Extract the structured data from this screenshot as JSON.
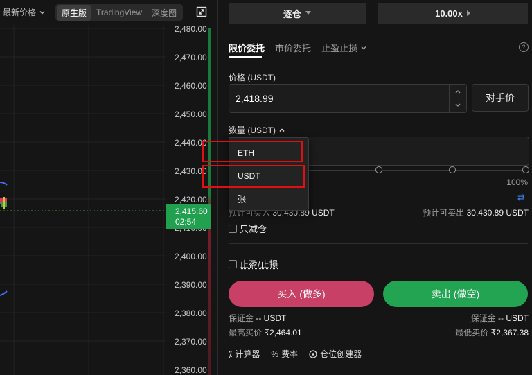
{
  "chart_toolbar": {
    "price_type": "最新价格",
    "views": [
      "原生版",
      "TradingView",
      "深度图"
    ],
    "active_view": "原生版"
  },
  "price_axis": {
    "ticks": [
      "2,480.00",
      "2,470.00",
      "2,460.00",
      "2,450.00",
      "2,440.00",
      "2,430.00",
      "2,420.00",
      "2,410.00",
      "2,400.00",
      "2,390.00",
      "2,380.00",
      "2,370.00",
      "2,360.00"
    ],
    "current_price": "2,415.60",
    "countdown": "02:54",
    "current_color": "#21a14f"
  },
  "order_panel": {
    "margin_mode": "逐仓",
    "leverage": "10.00x",
    "tabs": [
      "限价委托",
      "市价委托",
      "止盈止损"
    ],
    "active_tab": "限价委托",
    "price_label": "价格 (USDT)",
    "price_value": "2,418.99",
    "bbo_label": "对手价",
    "qty_label": "数量 (USDT)",
    "slider_max": "100%",
    "buy_available_label": "预计可买入",
    "buy_available_partial": "30,430.89 USDT",
    "sell_available_label": "预计可卖出",
    "sell_available_value": "30,430.89 USDT",
    "reduce_only": "只减仓",
    "tp_sl": "止盈/止损",
    "buy_button": "买入 (做多)",
    "sell_button": "卖出 (做空)",
    "margin_label": "保证金",
    "buy_margin": "-- USDT",
    "sell_margin": "-- USDT",
    "max_buy_label": "最高买价",
    "max_buy_value": "₹2,464.01",
    "min_sell_label": "最低卖价",
    "min_sell_value": "₹2,367.38",
    "tools": [
      "计算器",
      "费率",
      "仓位创建器"
    ],
    "buy_color": "#c94066",
    "sell_color": "#22a452"
  },
  "unit_dropdown": {
    "options": [
      "ETH",
      "USDT",
      "张"
    ]
  }
}
